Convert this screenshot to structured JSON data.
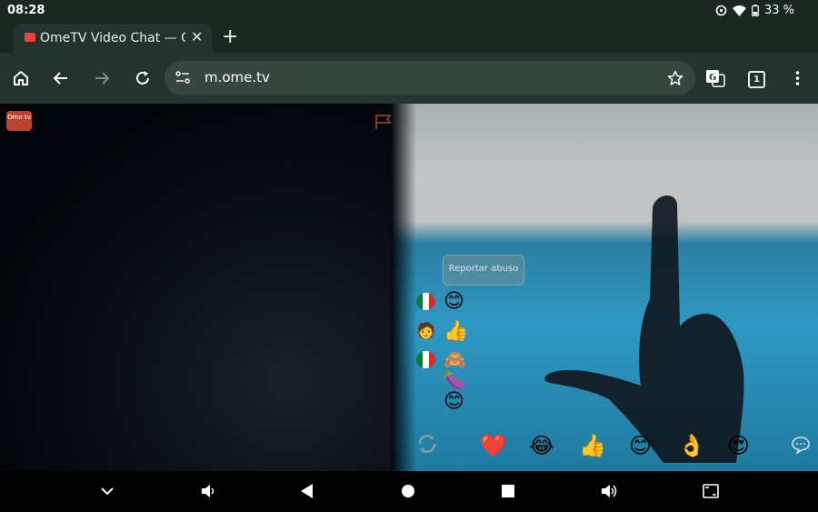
{
  "status_bar": {
    "time": "08:28",
    "battery": "33 %"
  },
  "tab": {
    "title": "OmeTV Video Chat — Omegle",
    "close": "✕"
  },
  "new_tab": "+",
  "toolbar": {
    "url": "m.ome.tv",
    "tab_count": "1"
  },
  "page": {
    "logo_text": "Ome tv",
    "report_abuse": "Reportar abuso",
    "chat_messages": [
      {
        "sender": "mexico-flag",
        "emoji": "😊"
      },
      {
        "sender": "user-avatar",
        "emoji": "👍"
      },
      {
        "sender": "mexico-flag",
        "emoji": "🙈🍆"
      },
      {
        "sender": "",
        "emoji": "😊"
      }
    ],
    "reactions": [
      "❤️",
      "😂",
      "👍",
      "😊",
      "👌",
      "😍"
    ]
  },
  "colors": {
    "browser_bg": "#24332d",
    "tab_strip": "#1a2620",
    "accent_red": "#e8443a"
  }
}
